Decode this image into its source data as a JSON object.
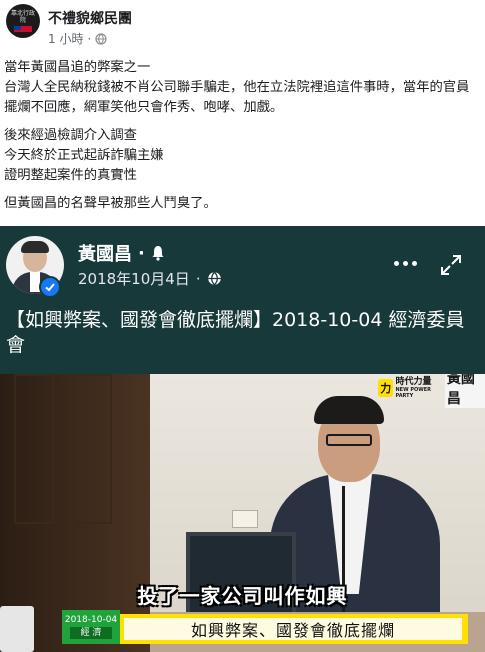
{
  "post": {
    "page_name": "不禮貌鄉民團",
    "time": "1 小時",
    "separator": "·",
    "avatar_text": "靠北行政院",
    "paragraphs": [
      "當年黃國昌追的弊案之一",
      "台灣人全民納稅錢被不肖公司聯手騙走，他在立法院裡追這件事時，當年的官員擺爛不回應，網軍笑他只會作秀、咆哮、加戲。",
      "後來經過檢調介入調查",
      "今天終於正式起訴詐騙主嫌",
      "證明整起案件的真實性",
      "但黃國昌的名聲早被那些人鬥臭了。"
    ]
  },
  "shared": {
    "name": "黃國昌",
    "name_suffix": "·",
    "date": "2018年10月4日",
    "date_separator": "·",
    "title": "【如興弊案、國發會徹底擺爛】2018-10-04 經濟委員會"
  },
  "video": {
    "logo_mark": "力",
    "logo_party": "時代力量",
    "logo_party_en": "NEW POWER PARTY",
    "logo_name": "黃國昌",
    "subtitle": "投了一家公司叫作如興",
    "lower_title": "如興弊案、國發會徹底擺爛",
    "badge_date": "2018-10-04",
    "badge_label": "經 濟"
  },
  "icons": {
    "globe": "globe-icon",
    "bell": "bell-icon",
    "verified": "verified-check-icon",
    "more": "more-dots-icon",
    "expand": "expand-icon"
  },
  "colors": {
    "card_bg": "#17393a",
    "verified": "#1877f2",
    "party_yellow": "#ffe000",
    "badge_green": "#20a33b"
  }
}
